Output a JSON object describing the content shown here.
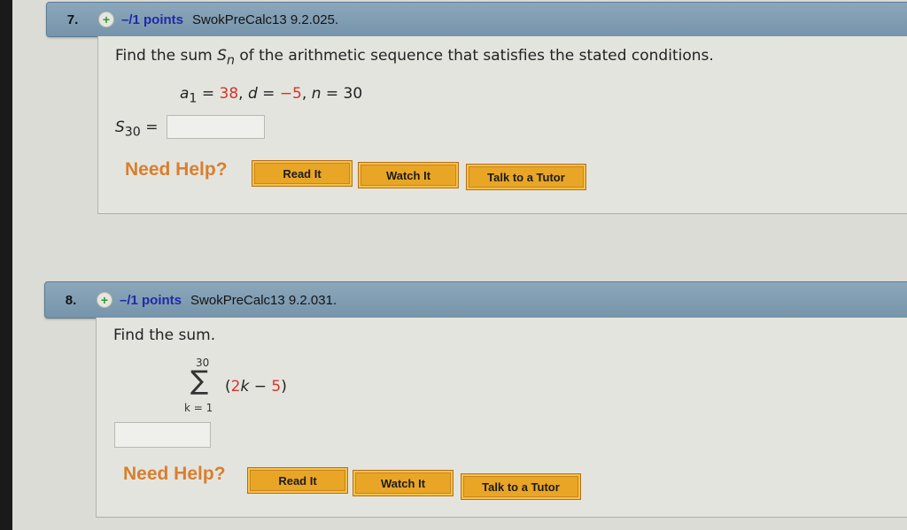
{
  "questions": [
    {
      "number": "7.",
      "points": "–/1 points",
      "source": "SwokPreCalc13 9.2.025.",
      "prompt_pre": "Find the sum ",
      "prompt_var": "S",
      "prompt_sub": "n",
      "prompt_post": " of the arithmetic sequence that satisfies the stated conditions.",
      "conditions": {
        "a_label": "a",
        "a_sub": "1",
        "eq": " = ",
        "a_value": "38",
        "sep1": ",  ",
        "d_label": "d",
        "d_value": "−5",
        "sep2": ",  ",
        "n_label": "n",
        "n_value": "30"
      },
      "answer_label": "S",
      "answer_sub": "30",
      "answer_eq": " =",
      "answer_value": "",
      "need_help": "Need Help?",
      "buttons": [
        "Read It",
        "Watch It",
        "Talk to a Tutor"
      ]
    },
    {
      "number": "8.",
      "points": "–/1 points",
      "source": "SwokPreCalc13 9.2.031.",
      "prompt": "Find the sum.",
      "sum": {
        "upper": "30",
        "symbol": "∑",
        "lower": "k = 1",
        "open": "(",
        "coef": "2",
        "var": "k",
        "minus": " − ",
        "const": "5",
        "close": ")"
      },
      "answer_value": "",
      "need_help": "Need Help?",
      "buttons": [
        "Read It",
        "Watch It",
        "Talk to a Tutor"
      ]
    }
  ],
  "colors": {
    "header_bg": "#7f9db2",
    "points_text": "#1f2aa8",
    "need_help": "#d97f2c",
    "help_button": "#e9a526",
    "highlight_red": "#d3352a"
  }
}
